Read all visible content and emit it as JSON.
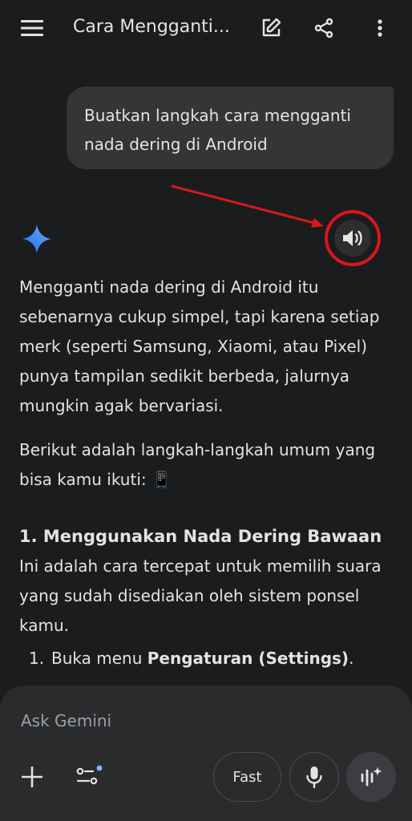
{
  "header": {
    "title": "Cara Mengganti...",
    "icons": [
      "menu-icon",
      "edit-icon",
      "share-icon",
      "more-vert-icon"
    ]
  },
  "user_message": {
    "text": "Buatkan langkah cara mengganti nada dering di Android"
  },
  "response": {
    "icons": [
      "gemini-spark-icon",
      "speaker-icon"
    ],
    "paragraph_1": "Mengganti nada dering di Android itu sebenarnya cukup simpel, tapi karena setiap merk (seperti Samsung, Xiaomi, atau Pixel) punya tampilan sedikit berbeda, jalurnya mungkin agak bervariasi.",
    "paragraph_2": "Berikut adalah langkah-langkah umum yang bisa kamu ikuti: 📱",
    "section_heading": "1. Menggunakan Nada Dering Bawaan",
    "section_intro": "Ini adalah cara tercepat untuk memilih suara yang sudah disediakan oleh sistem ponsel kamu.",
    "steps": [
      {
        "num": "1.",
        "prefix": "Buka menu ",
        "bold": "Pengaturan (Settings)",
        "suffix": "."
      }
    ]
  },
  "composer": {
    "placeholder": "Ask Gemini",
    "mode_label": "Fast",
    "icons": [
      "add-icon",
      "tools-icon",
      "mic-icon",
      "live-icon"
    ]
  },
  "colors": {
    "background": "#1b1c1d",
    "bubble": "#333537",
    "composer": "#2a2b2d",
    "annotation_red": "#d8171b",
    "accent_blue": "#4285f4"
  }
}
